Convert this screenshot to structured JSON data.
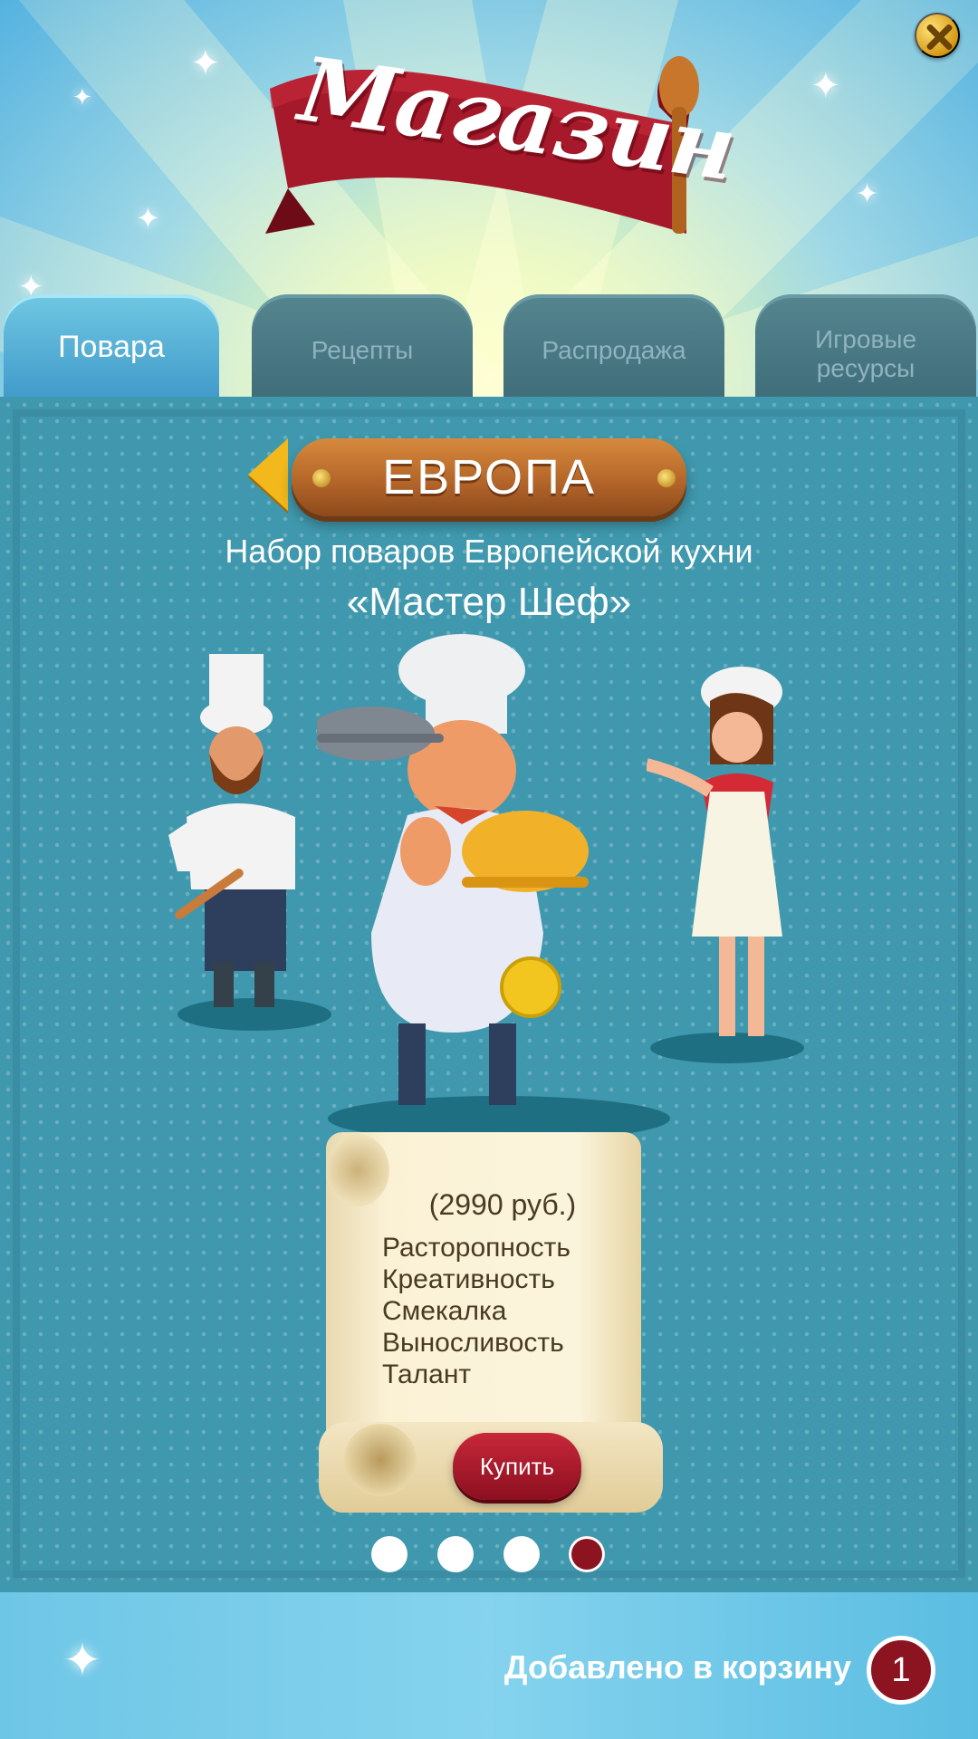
{
  "header": {
    "title": "Магазин"
  },
  "tabs": [
    {
      "label": "Повара",
      "active": true
    },
    {
      "label": "Рецепты",
      "active": false
    },
    {
      "label": "Распродажа",
      "active": false
    },
    {
      "label_line1": "Игровые",
      "label_line2": "ресурсы",
      "active": false
    }
  ],
  "region": {
    "name": "ЕВРОПА"
  },
  "offer": {
    "subtitle": "Набор поваров Европейской кухни",
    "name": "«Мастер Шеф»",
    "price": "(2990 руб.)",
    "perks": [
      "Расторопность",
      "Креативность",
      "Смекалка",
      "Выносливость",
      "Талант"
    ],
    "buy_label": "Купить"
  },
  "pagination": {
    "total": 4,
    "active_index": 3
  },
  "cart": {
    "label": "Добавлено в корзину",
    "count": "1"
  },
  "colors": {
    "panel": "#3f98ad",
    "accent_red": "#8c1421",
    "gold": "#f2b81c",
    "wood": "#b4662a"
  }
}
